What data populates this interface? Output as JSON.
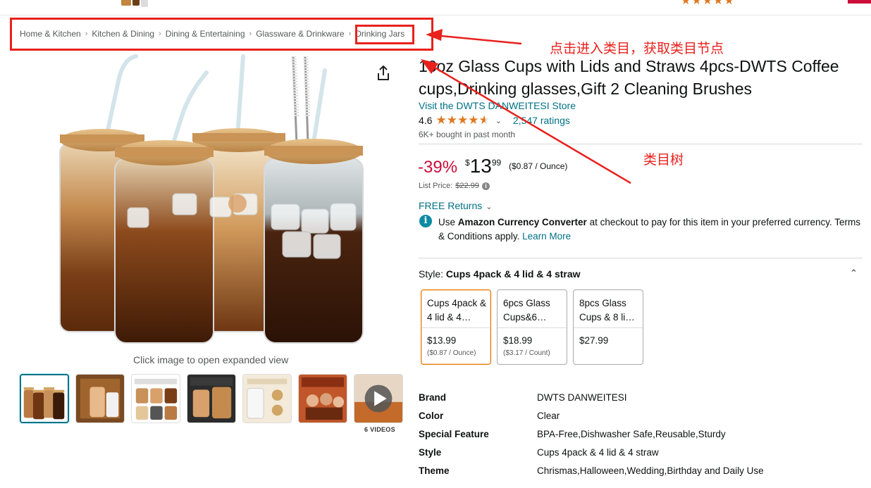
{
  "breadcrumb": {
    "items": [
      "Home & Kitchen",
      "Kitchen & Dining",
      "Dining & Entertaining",
      "Glassware & Drinkware",
      "Drinking Jars"
    ],
    "separator": "›"
  },
  "annotations": {
    "note1": "点击进入类目，获取类目节点",
    "note2": "类目树",
    "color": "#e8211d"
  },
  "gallery": {
    "caption": "Click image to open expanded view",
    "videos_label": "6 VIDEOS",
    "selected_index": 0
  },
  "product": {
    "title": "16oz Glass Cups with Lids and Straws 4pcs-DWTS Coffee cups,Drinking glasses,Gift 2 Cleaning Brushes",
    "store_link": "Visit the DWTS DANWEITESI Store",
    "rating": "4.6",
    "stars": 4.6,
    "ratings_count": "2,547 ratings",
    "bought": "6K+ bought in past month"
  },
  "pricing": {
    "discount": "-39%",
    "currency_symbol": "$",
    "price_whole": "13",
    "price_fraction": "99",
    "unit_price": "($0.87 / Ounce)",
    "list_price_label": "List Price:",
    "list_price": "$22.99",
    "free_returns": "FREE Returns"
  },
  "currency_notice": {
    "prefix": "Use ",
    "bold": "Amazon Currency Converter",
    "suffix": " at checkout to pay for this item in your preferred currency. Terms & Conditions apply. ",
    "learn_more": "Learn More"
  },
  "style_selector": {
    "label": "Style: ",
    "selected": "Cups 4pack & 4 lid & 4 straw",
    "options": [
      {
        "name": "Cups 4pack & 4 lid & 4…",
        "price": "$13.99",
        "unit": "($0.87 / Ounce)"
      },
      {
        "name": "6pcs Glass Cups&6…",
        "price": "$18.99",
        "unit": "($3.17 / Count)"
      },
      {
        "name": "8pcs Glass Cups & 8 li…",
        "price": "$27.99",
        "unit": ""
      }
    ]
  },
  "specs": [
    {
      "key": "Brand",
      "value": "DWTS DANWEITESI"
    },
    {
      "key": "Color",
      "value": "Clear"
    },
    {
      "key": "Special Feature",
      "value": "BPA-Free,Dishwasher Safe,Reusable,Sturdy"
    },
    {
      "key": "Style",
      "value": "Cups 4pack & 4 lid & 4 straw"
    },
    {
      "key": "Theme",
      "value": "Chrismas,Halloween,Wedding,Birthday and Daily Use"
    }
  ],
  "colors": {
    "link": "#007185",
    "deal": "#cc0c39",
    "star": "#de7921",
    "selected_border": "#e77600"
  }
}
